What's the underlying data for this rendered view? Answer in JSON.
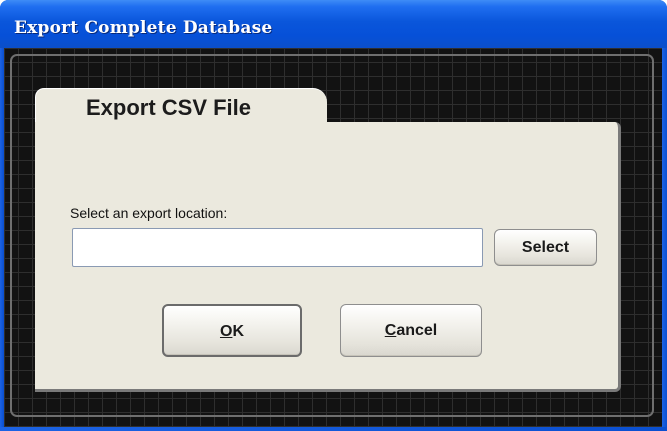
{
  "window": {
    "title": "Export Complete Database"
  },
  "tab": {
    "label": "Export CSV File"
  },
  "form": {
    "field_label": "Select an export location:",
    "location_value": "",
    "location_placeholder": ""
  },
  "buttons": {
    "select_label": "Select",
    "ok_mnemonic": "O",
    "ok_rest": "K",
    "cancel_mnemonic": "C",
    "cancel_rest": "ancel"
  },
  "colors": {
    "titlebar": "#0a56db",
    "panel": "#ebe9de",
    "canvas": "#121212"
  }
}
